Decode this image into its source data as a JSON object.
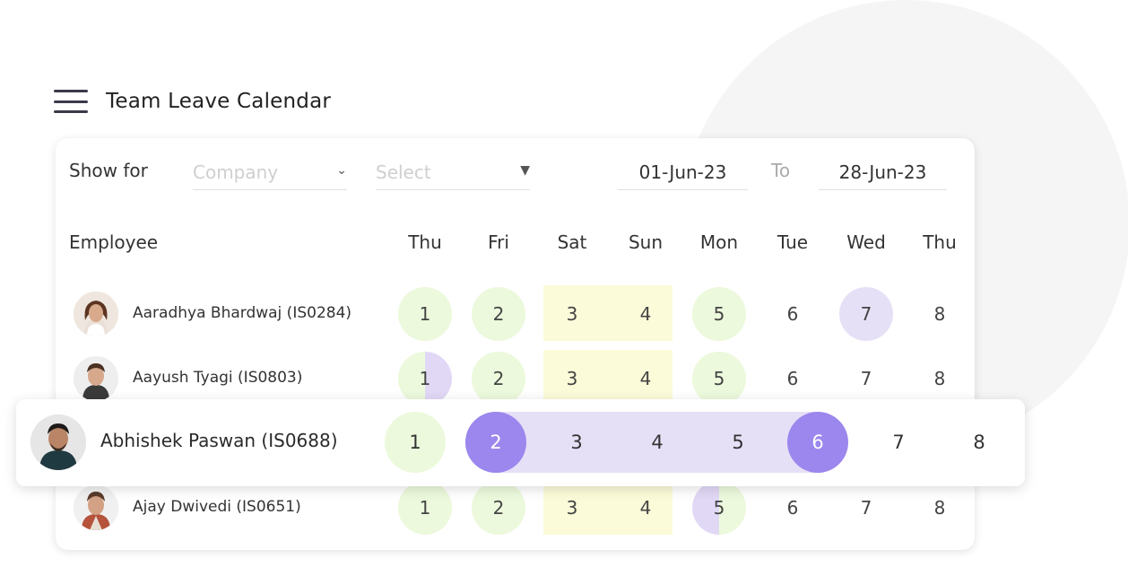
{
  "header": {
    "title": "Team Leave Calendar"
  },
  "filters": {
    "show_for_label": "Show for",
    "company_placeholder": "Company",
    "select_placeholder": "Select",
    "from_date": "01-Jun-23",
    "to_label": "To",
    "to_date": "28-Jun-23"
  },
  "table": {
    "employee_header": "Employee",
    "days": [
      "Thu",
      "Fri",
      "Sat",
      "Sun",
      "Mon",
      "Tue",
      "Wed",
      "Thu"
    ]
  },
  "rows": [
    {
      "name": "Aaradhya Bhardwaj (IS0284)",
      "dates": [
        "1",
        "2",
        "3",
        "4",
        "5",
        "6",
        "7",
        "8"
      ]
    },
    {
      "name": "Aayush Tyagi (IS0803)",
      "dates": [
        "1",
        "2",
        "3",
        "4",
        "5",
        "6",
        "7",
        "8"
      ]
    },
    {
      "name": "Ajay Dwivedi (IS0651)",
      "dates": [
        "1",
        "2",
        "3",
        "4",
        "5",
        "6",
        "7",
        "8"
      ]
    }
  ],
  "highlight_row": {
    "name": "Abhishek Paswan (IS0688)",
    "dates": [
      "1",
      "2",
      "3",
      "4",
      "5",
      "6",
      "7",
      "8"
    ]
  },
  "colors": {
    "present": "#ecf9dc",
    "weekend": "#fbfbd9",
    "leave": "#e6e0f7",
    "leave_strong": "#9b87ed"
  }
}
